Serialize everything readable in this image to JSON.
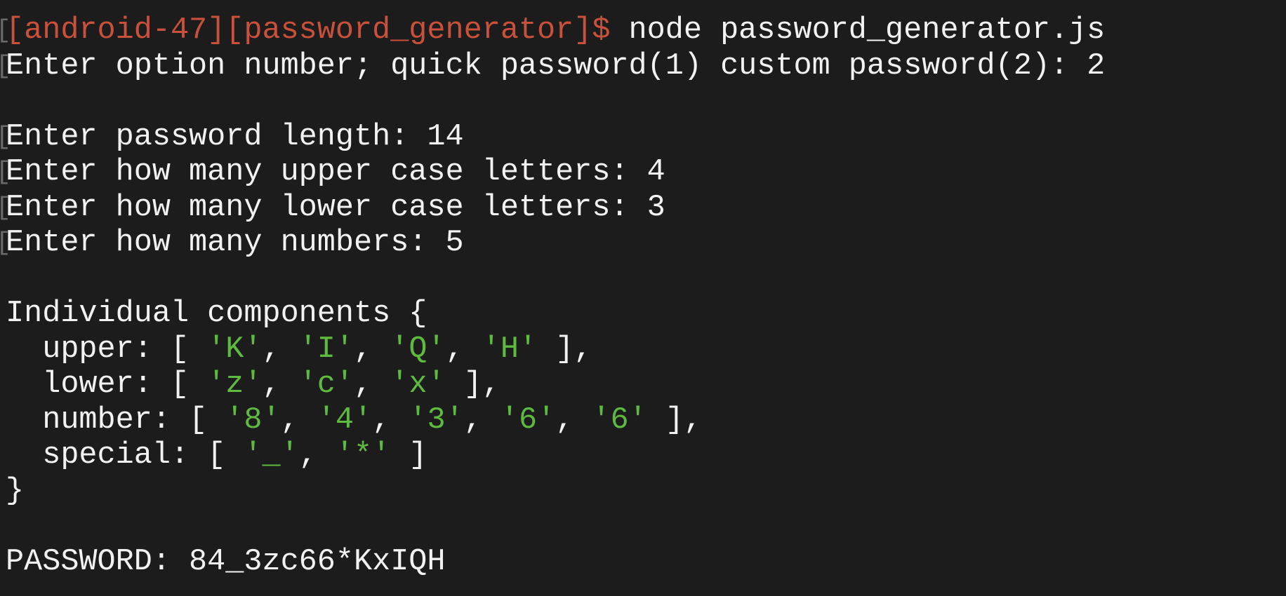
{
  "colors": {
    "background": "#1c1c1c",
    "prompt": "#c9503a",
    "string": "#5fbb3f",
    "text": "#f2f2f2"
  },
  "lines": [
    {
      "mark": "[",
      "segments": [
        {
          "t": "[android-47][password_generator]$ ",
          "c": "prompt"
        },
        {
          "t": "node password_generator.js",
          "c": "plain"
        }
      ]
    },
    {
      "mark": "[",
      "segments": [
        {
          "t": "Enter option number; quick password(1) custom password(2): 2",
          "c": "plain"
        }
      ]
    },
    {
      "segments": []
    },
    {
      "mark": "[",
      "segments": [
        {
          "t": "Enter password length: 14",
          "c": "plain"
        }
      ]
    },
    {
      "mark": "[",
      "segments": [
        {
          "t": "Enter how many upper case letters: 4",
          "c": "plain"
        }
      ]
    },
    {
      "mark": "[",
      "segments": [
        {
          "t": "Enter how many lower case letters: 3",
          "c": "plain"
        }
      ]
    },
    {
      "mark": "[",
      "segments": [
        {
          "t": "Enter how many numbers: 5",
          "c": "plain"
        }
      ]
    },
    {
      "segments": []
    },
    {
      "segments": [
        {
          "t": "Individual components {",
          "c": "plain"
        }
      ]
    },
    {
      "segments": [
        {
          "t": "  upper: [ ",
          "c": "plain"
        },
        {
          "t": "'K'",
          "c": "str"
        },
        {
          "t": ", ",
          "c": "plain"
        },
        {
          "t": "'I'",
          "c": "str"
        },
        {
          "t": ", ",
          "c": "plain"
        },
        {
          "t": "'Q'",
          "c": "str"
        },
        {
          "t": ", ",
          "c": "plain"
        },
        {
          "t": "'H'",
          "c": "str"
        },
        {
          "t": " ],",
          "c": "plain"
        }
      ]
    },
    {
      "segments": [
        {
          "t": "  lower: [ ",
          "c": "plain"
        },
        {
          "t": "'z'",
          "c": "str"
        },
        {
          "t": ", ",
          "c": "plain"
        },
        {
          "t": "'c'",
          "c": "str"
        },
        {
          "t": ", ",
          "c": "plain"
        },
        {
          "t": "'x'",
          "c": "str"
        },
        {
          "t": " ],",
          "c": "plain"
        }
      ]
    },
    {
      "segments": [
        {
          "t": "  number: [ ",
          "c": "plain"
        },
        {
          "t": "'8'",
          "c": "str"
        },
        {
          "t": ", ",
          "c": "plain"
        },
        {
          "t": "'4'",
          "c": "str"
        },
        {
          "t": ", ",
          "c": "plain"
        },
        {
          "t": "'3'",
          "c": "str"
        },
        {
          "t": ", ",
          "c": "plain"
        },
        {
          "t": "'6'",
          "c": "str"
        },
        {
          "t": ", ",
          "c": "plain"
        },
        {
          "t": "'6'",
          "c": "str"
        },
        {
          "t": " ],",
          "c": "plain"
        }
      ]
    },
    {
      "segments": [
        {
          "t": "  special: [ ",
          "c": "plain"
        },
        {
          "t": "'_'",
          "c": "str"
        },
        {
          "t": ", ",
          "c": "plain"
        },
        {
          "t": "'*'",
          "c": "str"
        },
        {
          "t": " ]",
          "c": "plain"
        }
      ]
    },
    {
      "segments": [
        {
          "t": "}",
          "c": "plain"
        }
      ]
    },
    {
      "segments": []
    },
    {
      "segments": [
        {
          "t": "PASSWORD: 84_3zc66*KxIQH",
          "c": "plain"
        }
      ]
    }
  ]
}
